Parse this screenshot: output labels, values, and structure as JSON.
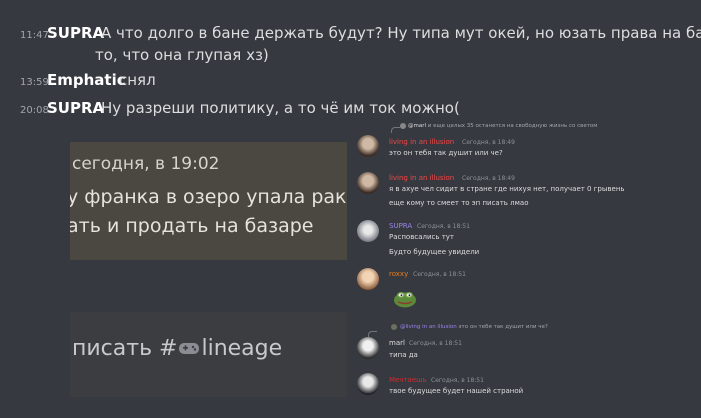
{
  "messages": [
    {
      "time": "11:47",
      "author": "SUPRA",
      "line1": "А что долго в бане держать будут? Ну типа мут окей, но юзать права на бан за",
      "line2": "то, что она глупая хз)"
    },
    {
      "time": "13:59",
      "author": "Emphatic",
      "line1": "снял"
    },
    {
      "time": "20:08",
      "author": "SUPRA",
      "line1": "Ну разреши политику, а то чё им ток можно("
    }
  ],
  "embed1": {
    "line1": "сегодня, в 19:02",
    "line2": "у франка в озеро упала ракет",
    "line3": "ать и продать на базаре"
  },
  "embed2": {
    "prefix": "писать #",
    "suffix": "lineage"
  },
  "discord": {
    "top_reply": {
      "name": "@marl",
      "text": "и еще целых 35 останется на свободную жизнь со светом"
    },
    "items": [
      {
        "name": "living in an illusion",
        "name_color": "#f04747",
        "time": "Сегодня, в 18:49",
        "lines": [
          "это он тебя так душит или че?"
        ]
      },
      {
        "name": "living in an illusion",
        "name_color": "#f04747",
        "time": "Сегодня, в 18:49",
        "lines": [
          "я в ахуе чел сидит в стране где нихуя нет, получает 0 грывень",
          "еще кому то смеет то эп писать лмао"
        ]
      },
      {
        "name": "SUPRA",
        "name_color": "#9b84ee",
        "time": "Сегодня, в 18:51",
        "lines": [
          "Расповсались тут",
          "Будто будущее увидели"
        ]
      },
      {
        "name": "roxxy",
        "name_color": "#e67e22",
        "time": "Сегодня, в 18:51",
        "lines": []
      },
      {
        "name": "marl",
        "name_color": "#dcddde",
        "time": "Сегодня, в 18:51",
        "lines": [
          "типа да"
        ]
      },
      {
        "name": "Мечтаешь",
        "name_color": "#d42c2c",
        "time": "Сегодня, в 18:51",
        "lines": [
          "твое будущее будет нашей страной"
        ]
      }
    ],
    "second_reply": {
      "name": "@living in an illusion",
      "text": "это он тебя так душит или че?"
    }
  }
}
